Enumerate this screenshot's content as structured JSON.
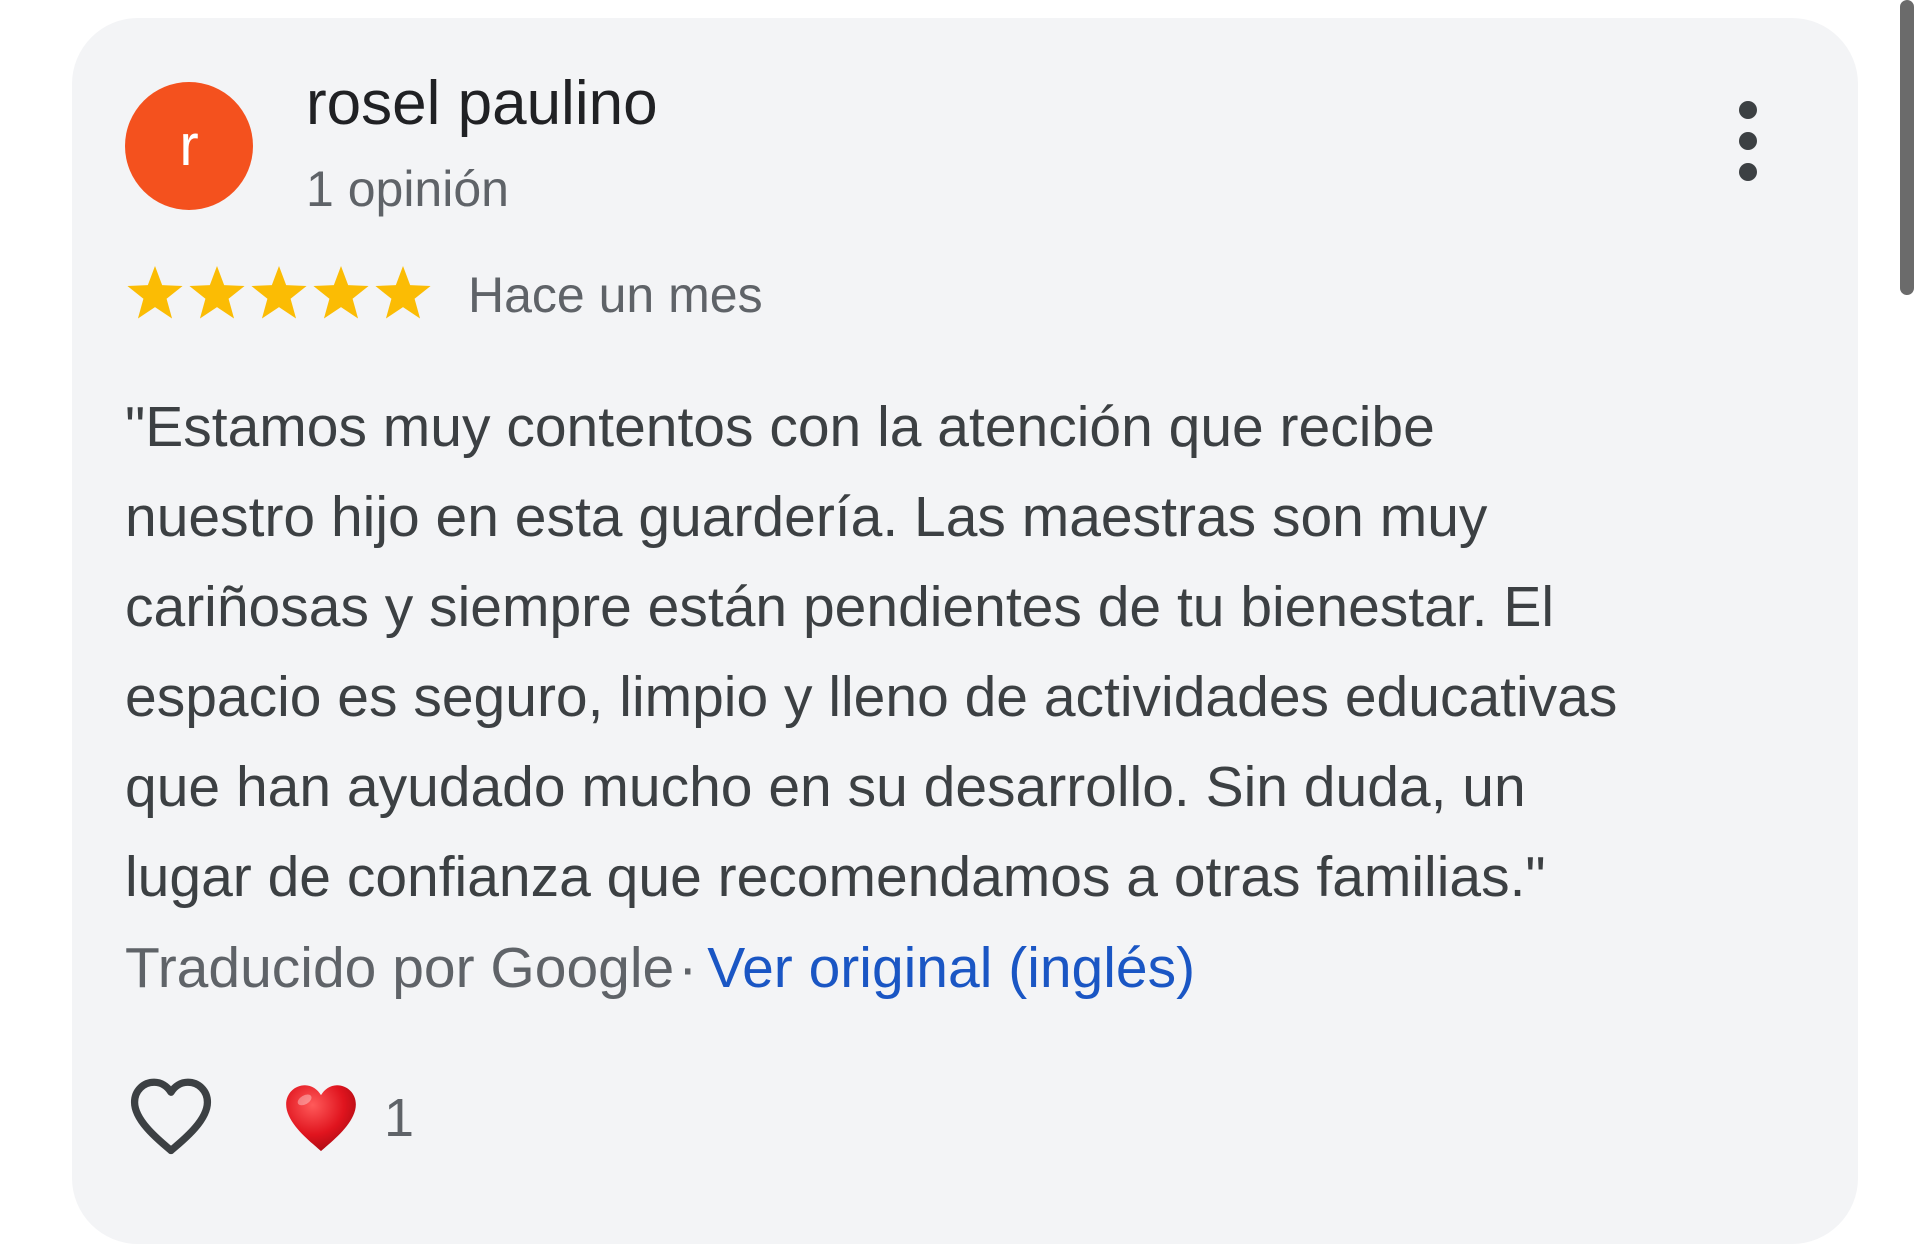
{
  "review": {
    "avatar_letter": "r",
    "avatar_color": "#f4511e",
    "author": "rosel paulino",
    "review_count": "1 opinión",
    "rating": 5,
    "rating_max": 5,
    "star_color": "#fbbc04",
    "date": "Hace un mes",
    "text_lines": [
      "\"Estamos muy contentos con la atención que recibe",
      "nuestro hijo en esta guardería. Las maestras son muy",
      "cariñosas y siempre están pendientes de tu bienestar. El",
      "espacio es seguro, limpio y lleno de actividades educativas",
      "que han ayudado mucho en su desarrollo. Sin duda, un",
      "lugar de confianza que recomendamos a otras familias.\""
    ],
    "translated_by": "Traducido por Google",
    "separator": "·",
    "original_link": "Ver original (inglés)",
    "link_color": "#1a56c4",
    "reaction_icon": "red-heart-icon",
    "reaction_count": "1"
  },
  "icons": {
    "menu": "more-vert-icon",
    "like": "heart-outline-icon"
  }
}
